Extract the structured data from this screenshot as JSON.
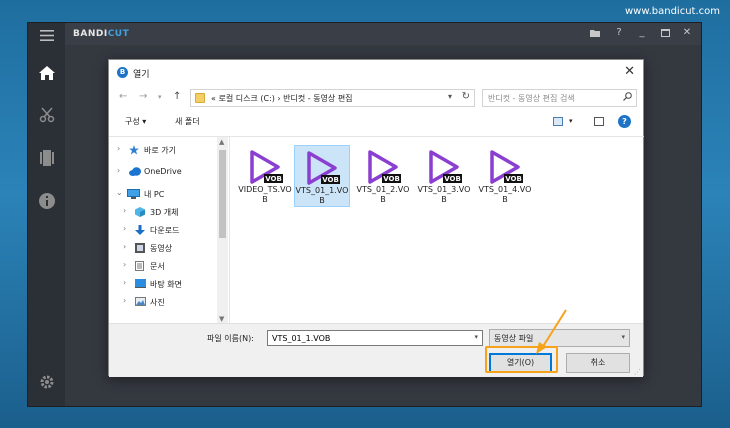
{
  "watermark": "www.bandicut.com",
  "app": {
    "brand_part1": "BANDI",
    "brand_part2": "CUT",
    "brand_accent": "#3fa2e0",
    "sidebar_icons": [
      "menu-icon",
      "home-icon",
      "cut-icon",
      "film-icon",
      "info-icon",
      "settings-icon"
    ],
    "title_controls": [
      "folder-icon",
      "help-icon",
      "minimize-icon",
      "maximize-icon",
      "close-icon"
    ],
    "title_controls_labels": {
      "help": "?",
      "minimize": "_",
      "close": "✕"
    }
  },
  "dialog": {
    "title": "열기",
    "title_icon_letter": "B",
    "address": {
      "prefix": "«",
      "path": "로컬 디스크 (C:)  ›  반디컷 - 동영상 편집"
    },
    "search_placeholder": "반디컷 - 동영상 편집 검색",
    "toolbar": {
      "organize": "구성 ▾",
      "new_folder": "새 폴더"
    },
    "nav_items": [
      {
        "label": "바로 가기",
        "icon": "star-icon"
      },
      {
        "label": "OneDrive",
        "icon": "cloud-icon"
      },
      {
        "label": "내 PC",
        "icon": "pc-icon"
      },
      {
        "label": "3D 개체",
        "icon": "cube-icon"
      },
      {
        "label": "다운로드",
        "icon": "download-icon"
      },
      {
        "label": "동영상",
        "icon": "video-icon"
      },
      {
        "label": "문서",
        "icon": "document-icon"
      },
      {
        "label": "바탕 화면",
        "icon": "desktop-icon"
      },
      {
        "label": "사진",
        "icon": "picture-icon"
      }
    ],
    "files": [
      {
        "name": "VIDEO_TS.VOB",
        "badge": "VOB",
        "selected": false
      },
      {
        "name": "VTS_01_1.VOB",
        "badge": "VOB",
        "selected": true
      },
      {
        "name": "VTS_01_2.VOB",
        "badge": "VOB",
        "selected": false
      },
      {
        "name": "VTS_01_3.VOB",
        "badge": "VOB",
        "selected": false
      },
      {
        "name": "VTS_01_4.VOB",
        "badge": "VOB",
        "selected": false
      }
    ],
    "filename_label": "파일 이름(N):",
    "filename_value": "VTS_01_1.VOB",
    "file_type": "동영상 파일",
    "open_button": "열기(O)",
    "cancel_button": "취소",
    "highlight_color": "#f7a21b",
    "icon_color": "#8a3fd1"
  }
}
